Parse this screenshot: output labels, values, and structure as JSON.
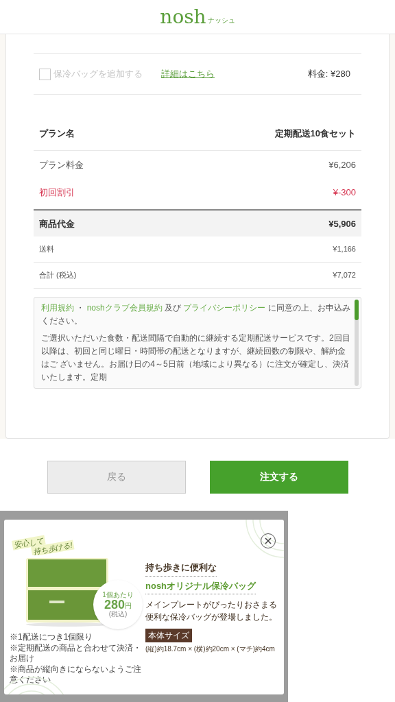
{
  "header": {
    "logo": "nosh",
    "logo_sub": "ナッシュ"
  },
  "option": {
    "label": "保冷バッグを追加する",
    "checked": false,
    "disabled": true,
    "link": "詳細はこちら",
    "price": "料金: ¥280"
  },
  "plan": {
    "label": "プラン名",
    "value": "定期配送10食セット"
  },
  "rows": [
    {
      "kind": "normal",
      "label": "プラン料金",
      "value": "¥6,206"
    },
    {
      "kind": "discount",
      "label": "初回割引",
      "value": "¥-300"
    },
    {
      "kind": "subtotal",
      "label": "商品代金",
      "value": "¥5,906"
    },
    {
      "kind": "small",
      "label": "送料",
      "value": "¥1,166"
    },
    {
      "kind": "small",
      "label": "合計 (税込)",
      "value": "¥7,072"
    }
  ],
  "terms": {
    "segments": [
      {
        "kind": "link",
        "text": "利用規約"
      },
      {
        "kind": "plain",
        "text": " ・ "
      },
      {
        "kind": "link",
        "text": "noshクラブ会員規約"
      },
      {
        "kind": "plain",
        "text": " 及び "
      },
      {
        "kind": "link",
        "text": "プライバシーポリシー"
      },
      {
        "kind": "plain",
        "text": " に同意の上、お申込みください。"
      }
    ],
    "paragraph": "ご選択いただいた食数・配送間隔で自動的に継続する定期配送サービスです。2回目以降は、初回と同じ曜日・時間帯の配送となりますが、継続回数の制限や、解約金はご ざいません。お届け日の4～5日前（地域により異なる）に注文が確定し、決済いたします。定期"
  },
  "buttons": [
    {
      "kind": "back",
      "label": "戻る"
    },
    {
      "kind": "primary",
      "label": "注文する"
    }
  ],
  "modal": {
    "tagline": [
      "安心して",
      "持ち歩ける!"
    ],
    "price_badge": {
      "top": "1個あたり",
      "amount": "280",
      "unit": "円",
      "note": "(税込)"
    },
    "notes": [
      "※1配送につき1個限り",
      "※定期配送の商品と合わせて決済・お届け",
      "※商品が縦向きにならないようご注意ください"
    ],
    "title": "持ち歩きに便利な",
    "subtitle": "noshオリジナル保冷バッグ",
    "description": [
      "メインプレートがぴったりおさまる",
      "便利な保冷バッグが登場しました。"
    ],
    "size_label": "本体サイズ",
    "size": "(縦)約18.7cm × (横)約20cm × (マチ)約4cm"
  }
}
